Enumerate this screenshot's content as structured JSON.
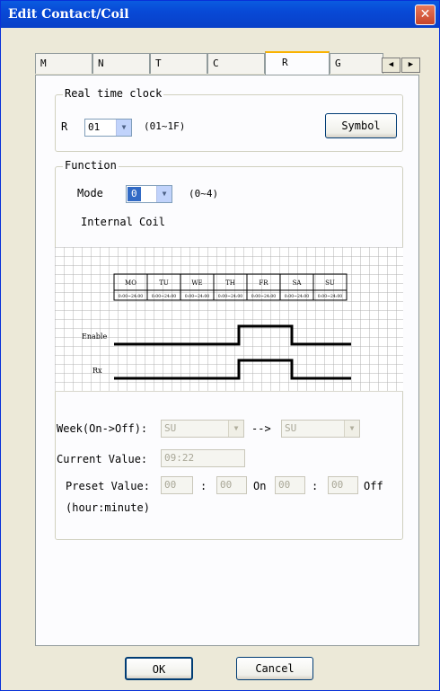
{
  "window": {
    "title": "Edit Contact/Coil"
  },
  "tabs": [
    {
      "label": "M"
    },
    {
      "label": "N"
    },
    {
      "label": "T"
    },
    {
      "label": "C"
    },
    {
      "label": "R",
      "active": true
    },
    {
      "label": "G"
    }
  ],
  "rtc_group": {
    "legend": "Real time clock",
    "r_label": "R",
    "r_value": "01",
    "range": "(01~1F)",
    "symbol_button": "Symbol"
  },
  "function_group": {
    "legend": "Function",
    "mode_label": "Mode",
    "mode_value": "0",
    "mode_range": "(0~4)",
    "mode_description": "Internal Coil"
  },
  "diagram": {
    "days": [
      "MO",
      "TU",
      "WE",
      "TH",
      "FR",
      "SA",
      "SU"
    ],
    "day_sublabel": "0:00~24:00",
    "signals": [
      "Enable",
      "Rx"
    ]
  },
  "week": {
    "label": "Week(On->Off):",
    "on_value": "SU",
    "arrow": "-->",
    "off_value": "SU"
  },
  "current": {
    "label": "Current Value:",
    "value": "09:22"
  },
  "preset": {
    "label": "Preset Value:",
    "on_hour": "00",
    "colon1": ":",
    "on_minute": "00",
    "on_label": "On",
    "off_hour": "00",
    "colon2": ":",
    "off_minute": "00",
    "off_label": "Off",
    "format_hint": "(hour:minute)"
  },
  "buttons": {
    "ok": "OK",
    "cancel": "Cancel"
  },
  "colors": {
    "titlebar": "#0849d6",
    "close": "#c6442a",
    "tab_highlight": "#f9b200",
    "dialog_bg": "#ece9d8"
  },
  "icons": {
    "close": "close-icon",
    "dropdown": "chevron-down-icon",
    "scroll_left": "arrow-left-icon",
    "scroll_right": "arrow-right-icon"
  }
}
